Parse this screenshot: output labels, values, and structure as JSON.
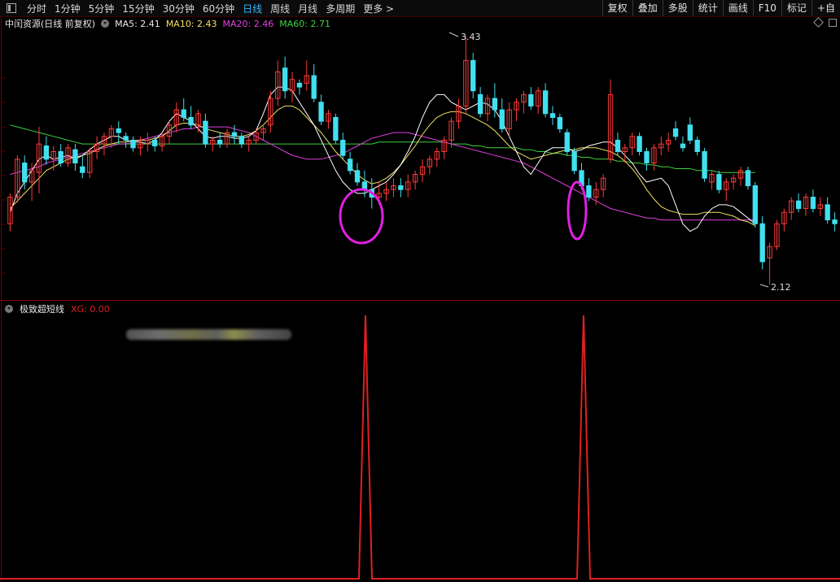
{
  "toolbar": {
    "periods": [
      "分时",
      "1分钟",
      "5分钟",
      "15分钟",
      "30分钟",
      "60分钟",
      "日线",
      "周线",
      "月线",
      "多周期",
      "更多 >"
    ],
    "active_index": 6,
    "right_buttons": [
      "复权",
      "叠加",
      "多股",
      "统计",
      "画线",
      "F10",
      "标记",
      "+自"
    ]
  },
  "chart_header": {
    "stock": "中闰资源(日线 前复权)",
    "ma5": "MA5: 2.41",
    "ma10": "MA10: 2.43",
    "ma20": "MA20: 2.46",
    "ma60": "MA60: 2.71"
  },
  "price_labels": {
    "high": "3.43",
    "low": "2.12"
  },
  "indicator": {
    "name": "极致超短线",
    "xg": "XG: 0.00"
  },
  "colors": {
    "up": "#ff3a3a",
    "down": "#40e0f0",
    "ma5": "#ffffff",
    "ma10": "#f0e060",
    "ma20": "#e040e0",
    "ma60": "#40d040",
    "signal": "#e02020",
    "circle": "#e020e0"
  },
  "chart_data": {
    "type": "candlestick",
    "price_range": [
      2.12,
      3.43
    ],
    "bars": [
      {
        "o": 2.44,
        "h": 2.6,
        "l": 2.4,
        "c": 2.58
      },
      {
        "o": 2.58,
        "h": 2.8,
        "l": 2.55,
        "c": 2.78
      },
      {
        "o": 2.76,
        "h": 2.8,
        "l": 2.62,
        "c": 2.66
      },
      {
        "o": 2.66,
        "h": 2.76,
        "l": 2.56,
        "c": 2.72
      },
      {
        "o": 2.71,
        "h": 2.95,
        "l": 2.6,
        "c": 2.86
      },
      {
        "o": 2.85,
        "h": 2.9,
        "l": 2.75,
        "c": 2.78
      },
      {
        "o": 2.78,
        "h": 2.85,
        "l": 2.72,
        "c": 2.82
      },
      {
        "o": 2.82,
        "h": 2.86,
        "l": 2.74,
        "c": 2.76
      },
      {
        "o": 2.76,
        "h": 2.86,
        "l": 2.74,
        "c": 2.84
      },
      {
        "o": 2.83,
        "h": 2.86,
        "l": 2.72,
        "c": 2.76
      },
      {
        "o": 2.74,
        "h": 2.8,
        "l": 2.68,
        "c": 2.71
      },
      {
        "o": 2.71,
        "h": 2.84,
        "l": 2.68,
        "c": 2.82
      },
      {
        "o": 2.82,
        "h": 2.9,
        "l": 2.78,
        "c": 2.86
      },
      {
        "o": 2.86,
        "h": 2.92,
        "l": 2.8,
        "c": 2.9
      },
      {
        "o": 2.9,
        "h": 2.96,
        "l": 2.84,
        "c": 2.94
      },
      {
        "o": 2.94,
        "h": 2.98,
        "l": 2.86,
        "c": 2.92
      },
      {
        "o": 2.9,
        "h": 2.92,
        "l": 2.84,
        "c": 2.88
      },
      {
        "o": 2.88,
        "h": 2.9,
        "l": 2.82,
        "c": 2.84
      },
      {
        "o": 2.84,
        "h": 2.9,
        "l": 2.8,
        "c": 2.86
      },
      {
        "o": 2.86,
        "h": 2.92,
        "l": 2.82,
        "c": 2.88
      },
      {
        "o": 2.88,
        "h": 2.9,
        "l": 2.82,
        "c": 2.85
      },
      {
        "o": 2.85,
        "h": 2.92,
        "l": 2.82,
        "c": 2.9
      },
      {
        "o": 2.9,
        "h": 2.98,
        "l": 2.86,
        "c": 2.96
      },
      {
        "o": 2.96,
        "h": 3.08,
        "l": 2.92,
        "c": 3.04
      },
      {
        "o": 3.04,
        "h": 3.1,
        "l": 2.98,
        "c": 3.0
      },
      {
        "o": 3.0,
        "h": 3.06,
        "l": 2.94,
        "c": 2.96
      },
      {
        "o": 2.96,
        "h": 3.04,
        "l": 2.92,
        "c": 3.02
      },
      {
        "o": 2.98,
        "h": 3.02,
        "l": 2.84,
        "c": 2.86
      },
      {
        "o": 2.86,
        "h": 2.9,
        "l": 2.82,
        "c": 2.88
      },
      {
        "o": 2.88,
        "h": 2.92,
        "l": 2.84,
        "c": 2.86
      },
      {
        "o": 2.86,
        "h": 2.94,
        "l": 2.84,
        "c": 2.92
      },
      {
        "o": 2.92,
        "h": 2.96,
        "l": 2.86,
        "c": 2.9
      },
      {
        "o": 2.9,
        "h": 2.92,
        "l": 2.84,
        "c": 2.86
      },
      {
        "o": 2.86,
        "h": 2.9,
        "l": 2.82,
        "c": 2.88
      },
      {
        "o": 2.88,
        "h": 2.94,
        "l": 2.86,
        "c": 2.92
      },
      {
        "o": 2.92,
        "h": 2.96,
        "l": 2.88,
        "c": 2.94
      },
      {
        "o": 2.96,
        "h": 3.14,
        "l": 2.92,
        "c": 3.1
      },
      {
        "o": 3.1,
        "h": 3.3,
        "l": 3.06,
        "c": 3.24
      },
      {
        "o": 3.26,
        "h": 3.32,
        "l": 3.1,
        "c": 3.14
      },
      {
        "o": 3.14,
        "h": 3.24,
        "l": 3.08,
        "c": 3.2
      },
      {
        "o": 3.18,
        "h": 3.2,
        "l": 3.12,
        "c": 3.16
      },
      {
        "o": 3.18,
        "h": 3.3,
        "l": 3.14,
        "c": 3.22
      },
      {
        "o": 3.22,
        "h": 3.28,
        "l": 3.08,
        "c": 3.1
      },
      {
        "o": 3.08,
        "h": 3.12,
        "l": 2.96,
        "c": 2.98
      },
      {
        "o": 2.98,
        "h": 3.04,
        "l": 2.94,
        "c": 3.02
      },
      {
        "o": 3.0,
        "h": 3.02,
        "l": 2.86,
        "c": 2.88
      },
      {
        "o": 2.88,
        "h": 2.92,
        "l": 2.78,
        "c": 2.8
      },
      {
        "o": 2.78,
        "h": 2.82,
        "l": 2.7,
        "c": 2.72
      },
      {
        "o": 2.72,
        "h": 2.76,
        "l": 2.64,
        "c": 2.66
      },
      {
        "o": 2.66,
        "h": 2.72,
        "l": 2.58,
        "c": 2.62
      },
      {
        "o": 2.62,
        "h": 2.68,
        "l": 2.52,
        "c": 2.58
      },
      {
        "o": 2.58,
        "h": 2.66,
        "l": 2.54,
        "c": 2.6
      },
      {
        "o": 2.6,
        "h": 2.66,
        "l": 2.56,
        "c": 2.62
      },
      {
        "o": 2.62,
        "h": 2.68,
        "l": 2.58,
        "c": 2.64
      },
      {
        "o": 2.64,
        "h": 2.68,
        "l": 2.58,
        "c": 2.62
      },
      {
        "o": 2.62,
        "h": 2.7,
        "l": 2.58,
        "c": 2.66
      },
      {
        "o": 2.66,
        "h": 2.72,
        "l": 2.62,
        "c": 2.7
      },
      {
        "o": 2.7,
        "h": 2.78,
        "l": 2.66,
        "c": 2.74
      },
      {
        "o": 2.74,
        "h": 2.8,
        "l": 2.7,
        "c": 2.78
      },
      {
        "o": 2.78,
        "h": 2.84,
        "l": 2.74,
        "c": 2.82
      },
      {
        "o": 2.82,
        "h": 2.9,
        "l": 2.78,
        "c": 2.88
      },
      {
        "o": 2.88,
        "h": 3.0,
        "l": 2.84,
        "c": 2.98
      },
      {
        "o": 2.98,
        "h": 3.1,
        "l": 2.94,
        "c": 3.06
      },
      {
        "o": 3.06,
        "h": 3.43,
        "l": 3.02,
        "c": 3.3
      },
      {
        "o": 3.3,
        "h": 3.34,
        "l": 3.1,
        "c": 3.14
      },
      {
        "o": 3.12,
        "h": 3.16,
        "l": 3.0,
        "c": 3.02
      },
      {
        "o": 3.02,
        "h": 3.12,
        "l": 2.98,
        "c": 3.1
      },
      {
        "o": 3.1,
        "h": 3.18,
        "l": 3.0,
        "c": 3.04
      },
      {
        "o": 3.04,
        "h": 3.1,
        "l": 2.92,
        "c": 2.94
      },
      {
        "o": 2.94,
        "h": 3.08,
        "l": 2.9,
        "c": 3.04
      },
      {
        "o": 3.04,
        "h": 3.1,
        "l": 2.98,
        "c": 3.08
      },
      {
        "o": 3.08,
        "h": 3.14,
        "l": 3.02,
        "c": 3.12
      },
      {
        "o": 3.12,
        "h": 3.16,
        "l": 3.04,
        "c": 3.06
      },
      {
        "o": 3.06,
        "h": 3.16,
        "l": 3.02,
        "c": 3.14
      },
      {
        "o": 3.14,
        "h": 3.18,
        "l": 3.0,
        "c": 3.02
      },
      {
        "o": 3.02,
        "h": 3.06,
        "l": 2.96,
        "c": 3.0
      },
      {
        "o": 3.0,
        "h": 3.02,
        "l": 2.92,
        "c": 2.94
      },
      {
        "o": 2.92,
        "h": 2.94,
        "l": 2.8,
        "c": 2.82
      },
      {
        "o": 2.82,
        "h": 2.84,
        "l": 2.7,
        "c": 2.72
      },
      {
        "o": 2.72,
        "h": 2.76,
        "l": 2.62,
        "c": 2.64
      },
      {
        "o": 2.64,
        "h": 2.68,
        "l": 2.56,
        "c": 2.58
      },
      {
        "o": 2.58,
        "h": 2.66,
        "l": 2.54,
        "c": 2.62
      },
      {
        "o": 2.62,
        "h": 2.7,
        "l": 2.58,
        "c": 2.68
      },
      {
        "o": 2.78,
        "h": 3.2,
        "l": 2.76,
        "c": 3.12
      },
      {
        "o": 2.88,
        "h": 2.92,
        "l": 2.8,
        "c": 2.82
      },
      {
        "o": 2.82,
        "h": 2.86,
        "l": 2.76,
        "c": 2.84
      },
      {
        "o": 2.84,
        "h": 2.92,
        "l": 2.8,
        "c": 2.9
      },
      {
        "o": 2.9,
        "h": 2.92,
        "l": 2.8,
        "c": 2.82
      },
      {
        "o": 2.82,
        "h": 2.84,
        "l": 2.72,
        "c": 2.76
      },
      {
        "o": 2.76,
        "h": 2.86,
        "l": 2.72,
        "c": 2.84
      },
      {
        "o": 2.84,
        "h": 2.9,
        "l": 2.8,
        "c": 2.86
      },
      {
        "o": 2.86,
        "h": 2.92,
        "l": 2.82,
        "c": 2.88
      },
      {
        "o": 2.94,
        "h": 2.98,
        "l": 2.88,
        "c": 2.9
      },
      {
        "o": 2.86,
        "h": 2.9,
        "l": 2.82,
        "c": 2.84
      },
      {
        "o": 2.96,
        "h": 3.0,
        "l": 2.86,
        "c": 2.88
      },
      {
        "o": 2.88,
        "h": 2.9,
        "l": 2.8,
        "c": 2.82
      },
      {
        "o": 2.82,
        "h": 2.84,
        "l": 2.66,
        "c": 2.68
      },
      {
        "o": 2.66,
        "h": 2.72,
        "l": 2.62,
        "c": 2.7
      },
      {
        "o": 2.7,
        "h": 2.72,
        "l": 2.6,
        "c": 2.62
      },
      {
        "o": 2.62,
        "h": 2.68,
        "l": 2.56,
        "c": 2.66
      },
      {
        "o": 2.66,
        "h": 2.7,
        "l": 2.62,
        "c": 2.68
      },
      {
        "o": 2.68,
        "h": 2.74,
        "l": 2.64,
        "c": 2.72
      },
      {
        "o": 2.72,
        "h": 2.74,
        "l": 2.62,
        "c": 2.64
      },
      {
        "o": 2.64,
        "h": 2.66,
        "l": 2.42,
        "c": 2.44
      },
      {
        "o": 2.44,
        "h": 2.48,
        "l": 2.2,
        "c": 2.24
      },
      {
        "o": 2.26,
        "h": 2.34,
        "l": 2.12,
        "c": 2.32
      },
      {
        "o": 2.32,
        "h": 2.46,
        "l": 2.3,
        "c": 2.44
      },
      {
        "o": 2.44,
        "h": 2.52,
        "l": 2.4,
        "c": 2.5
      },
      {
        "o": 2.5,
        "h": 2.58,
        "l": 2.46,
        "c": 2.56
      },
      {
        "o": 2.56,
        "h": 2.6,
        "l": 2.5,
        "c": 2.52
      },
      {
        "o": 2.52,
        "h": 2.6,
        "l": 2.48,
        "c": 2.58
      },
      {
        "o": 2.58,
        "h": 2.62,
        "l": 2.5,
        "c": 2.52
      },
      {
        "o": 2.52,
        "h": 2.58,
        "l": 2.48,
        "c": 2.54
      },
      {
        "o": 2.54,
        "h": 2.58,
        "l": 2.44,
        "c": 2.46
      },
      {
        "o": 2.46,
        "h": 2.5,
        "l": 2.4,
        "c": 2.44
      }
    ],
    "ma5": [
      2.5,
      2.6,
      2.66,
      2.72,
      2.78,
      2.8,
      2.78,
      2.79,
      2.8,
      2.78,
      2.8,
      2.83,
      2.86,
      2.88,
      2.9,
      2.9,
      2.88,
      2.87,
      2.87,
      2.86,
      2.88,
      2.92,
      2.98,
      3.02,
      3.0,
      2.98,
      2.94,
      2.9,
      2.89,
      2.9,
      2.9,
      2.89,
      2.89,
      2.9,
      2.93,
      3.02,
      3.12,
      3.16,
      3.16,
      3.14,
      3.08,
      3.02,
      2.96,
      2.88,
      2.8,
      2.72,
      2.66,
      2.62,
      2.6,
      2.6,
      2.62,
      2.64,
      2.66,
      2.7,
      2.75,
      2.82,
      2.9,
      3.0,
      3.08,
      3.12,
      3.12,
      3.08,
      3.06,
      3.04,
      3.06,
      3.08,
      3.07,
      3.04,
      2.98,
      2.9,
      2.82,
      2.74,
      2.7,
      2.76,
      2.82,
      2.84,
      2.84,
      2.84,
      2.82,
      2.83,
      2.85,
      2.86,
      2.87,
      2.87,
      2.84,
      2.8,
      2.76,
      2.7,
      2.66,
      2.67,
      2.68,
      2.64,
      2.54,
      2.44,
      2.4,
      2.42,
      2.48,
      2.52,
      2.54,
      2.54,
      2.53,
      2.5,
      2.47,
      2.44
    ],
    "ma10": [
      2.52,
      2.56,
      2.6,
      2.64,
      2.68,
      2.72,
      2.74,
      2.76,
      2.78,
      2.79,
      2.8,
      2.81,
      2.83,
      2.85,
      2.86,
      2.87,
      2.87,
      2.88,
      2.88,
      2.88,
      2.89,
      2.9,
      2.93,
      2.96,
      2.97,
      2.97,
      2.96,
      2.94,
      2.93,
      2.92,
      2.91,
      2.9,
      2.9,
      2.91,
      2.93,
      2.96,
      3.0,
      3.04,
      3.06,
      3.06,
      3.04,
      3.0,
      2.96,
      2.92,
      2.87,
      2.82,
      2.78,
      2.74,
      2.7,
      2.67,
      2.65,
      2.66,
      2.68,
      2.71,
      2.75,
      2.8,
      2.85,
      2.91,
      2.96,
      3.0,
      3.02,
      3.03,
      3.03,
      3.02,
      3.0,
      2.98,
      2.96,
      2.93,
      2.89,
      2.85,
      2.82,
      2.8,
      2.78,
      2.79,
      2.8,
      2.81,
      2.82,
      2.83,
      2.83,
      2.84,
      2.84,
      2.84,
      2.83,
      2.82,
      2.8,
      2.77,
      2.73,
      2.68,
      2.62,
      2.57,
      2.53,
      2.51,
      2.5,
      2.49,
      2.49,
      2.49,
      2.5,
      2.5,
      2.5,
      2.49,
      2.48,
      2.46,
      2.45,
      2.43
    ],
    "ma20": [
      2.7,
      2.71,
      2.72,
      2.73,
      2.74,
      2.76,
      2.77,
      2.78,
      2.79,
      2.8,
      2.81,
      2.82,
      2.83,
      2.84,
      2.85,
      2.86,
      2.86,
      2.87,
      2.88,
      2.89,
      2.9,
      2.91,
      2.92,
      2.93,
      2.94,
      2.94,
      2.95,
      2.95,
      2.95,
      2.95,
      2.95,
      2.94,
      2.93,
      2.92,
      2.9,
      2.88,
      2.86,
      2.84,
      2.82,
      2.8,
      2.79,
      2.78,
      2.78,
      2.78,
      2.79,
      2.8,
      2.81,
      2.83,
      2.85,
      2.87,
      2.89,
      2.9,
      2.91,
      2.92,
      2.92,
      2.92,
      2.91,
      2.9,
      2.89,
      2.88,
      2.87,
      2.86,
      2.85,
      2.84,
      2.83,
      2.82,
      2.81,
      2.8,
      2.79,
      2.78,
      2.77,
      2.76,
      2.74,
      2.72,
      2.7,
      2.68,
      2.66,
      2.64,
      2.62,
      2.6,
      2.58,
      2.56,
      2.54,
      2.52,
      2.51,
      2.5,
      2.49,
      2.48,
      2.47,
      2.47,
      2.46,
      2.46,
      2.46,
      2.46,
      2.46,
      2.46,
      2.46,
      2.46,
      2.46,
      2.46,
      2.46,
      2.46,
      2.46,
      2.46
    ],
    "ma60": [
      2.96,
      2.95,
      2.94,
      2.93,
      2.92,
      2.91,
      2.9,
      2.89,
      2.88,
      2.87,
      2.86,
      2.86,
      2.86,
      2.86,
      2.86,
      2.86,
      2.86,
      2.86,
      2.86,
      2.86,
      2.86,
      2.86,
      2.86,
      2.86,
      2.86,
      2.86,
      2.86,
      2.86,
      2.86,
      2.86,
      2.86,
      2.86,
      2.86,
      2.86,
      2.86,
      2.86,
      2.86,
      2.86,
      2.86,
      2.86,
      2.86,
      2.86,
      2.86,
      2.86,
      2.86,
      2.86,
      2.86,
      2.86,
      2.86,
      2.86,
      2.86,
      2.87,
      2.87,
      2.87,
      2.87,
      2.87,
      2.87,
      2.87,
      2.87,
      2.87,
      2.87,
      2.86,
      2.86,
      2.86,
      2.85,
      2.85,
      2.84,
      2.84,
      2.84,
      2.84,
      2.84,
      2.83,
      2.83,
      2.82,
      2.82,
      2.81,
      2.81,
      2.8,
      2.8,
      2.79,
      2.79,
      2.78,
      2.78,
      2.78,
      2.77,
      2.77,
      2.76,
      2.76,
      2.75,
      2.75,
      2.74,
      2.74,
      2.73,
      2.73,
      2.73,
      2.72,
      2.72,
      2.72,
      2.71,
      2.71,
      2.71,
      2.71,
      2.71,
      2.71
    ],
    "xg_signals": [
      54,
      87
    ],
    "highlighted_bars": [
      54,
      87
    ]
  }
}
